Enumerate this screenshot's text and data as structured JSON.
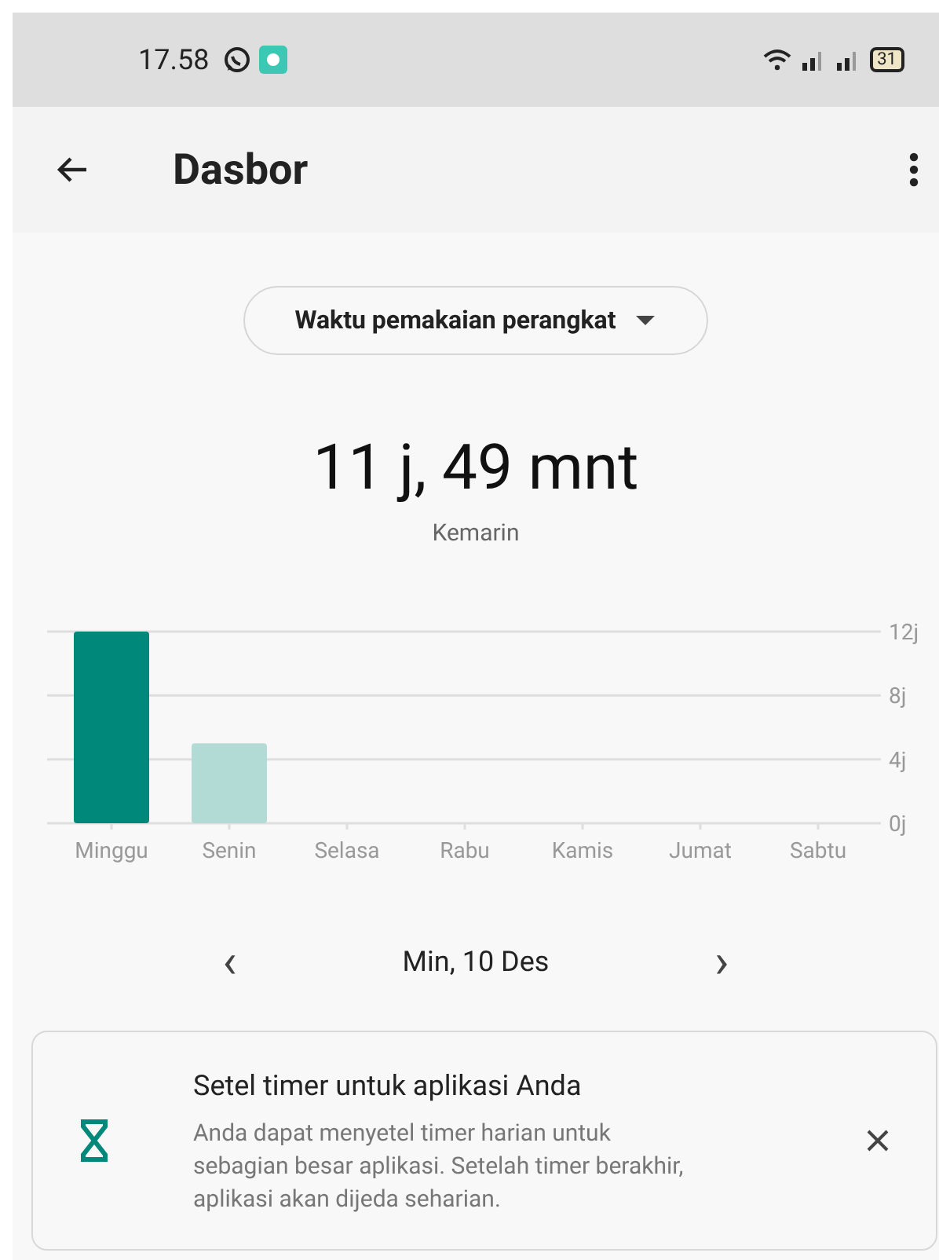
{
  "status_bar": {
    "time": "17.58",
    "battery": "31"
  },
  "app_bar": {
    "title": "Dasbor"
  },
  "dropdown": {
    "label": "Waktu pemakaian perangkat"
  },
  "summary": {
    "total": "11 j, 49 mnt",
    "day": "Kemarin"
  },
  "chart_data": {
    "type": "bar",
    "categories": [
      "Minggu",
      "Senin",
      "Selasa",
      "Rabu",
      "Kamis",
      "Jumat",
      "Sabtu"
    ],
    "series": [
      {
        "color": "#00887a",
        "values": [
          12,
          null,
          null,
          null,
          null,
          null,
          null
        ]
      },
      {
        "color": "#b2dbd6",
        "values": [
          null,
          5,
          null,
          null,
          null,
          null,
          null
        ]
      }
    ],
    "ylim": [
      0,
      12
    ],
    "yticks": [
      {
        "value": 0,
        "label": "0j"
      },
      {
        "value": 4,
        "label": "4j"
      },
      {
        "value": 8,
        "label": "8j"
      },
      {
        "value": 12,
        "label": "12j"
      }
    ]
  },
  "date_nav": {
    "prev": "‹",
    "date": "Min, 10 Des",
    "next": "›"
  },
  "tip_card": {
    "title": "Setel timer untuk aplikasi Anda",
    "body": "Anda dapat menyetel timer harian untuk sebagian besar aplikasi. Setelah timer berakhir, aplikasi akan dijeda seharian."
  }
}
